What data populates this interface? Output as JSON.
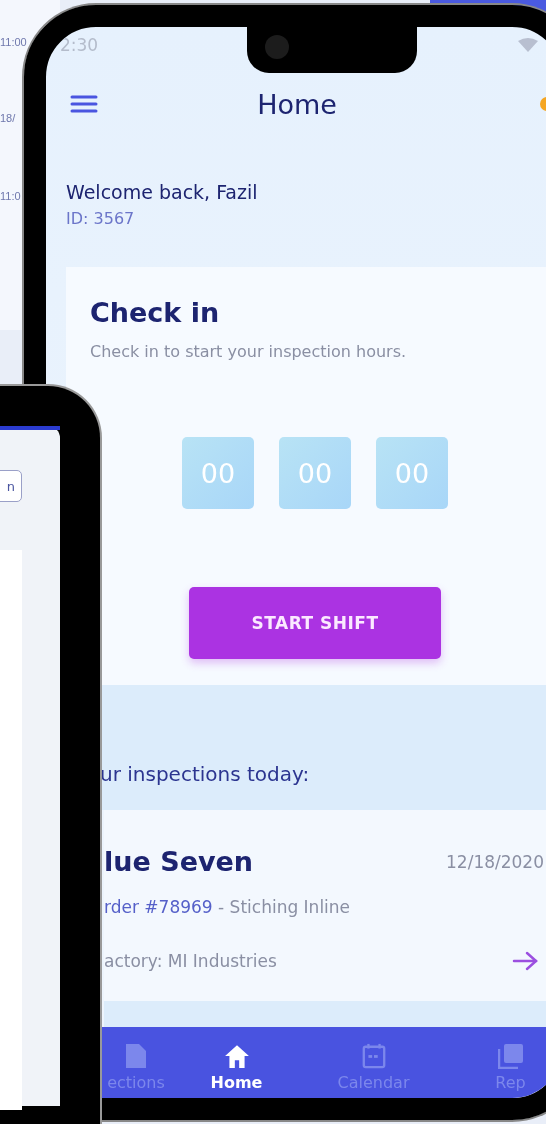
{
  "back_tablet": {
    "times": [
      "11:00",
      "18/",
      "11:0"
    ]
  },
  "phone": {
    "status_bar": {
      "time": "2:30"
    },
    "header": {
      "title": "Home"
    },
    "welcome": "Welcome back, Fazil",
    "user_id": "ID: 3567",
    "check_in": {
      "title": "Check in",
      "subtitle": "Check in to start your inspection hours.",
      "timer": [
        "00",
        "00",
        "00"
      ],
      "button": "START SHIFT"
    },
    "inspections": {
      "heading": "ur inspections today:",
      "items": [
        {
          "name": "lue Seven",
          "date": "12/18/2020",
          "order": "rder #78969",
          "task": "- Stiching Inline",
          "factory": "actory: MI Industries"
        }
      ]
    },
    "bottom_nav": [
      {
        "kind": "document",
        "label": "ections",
        "selected": false
      },
      {
        "kind": "home",
        "label": "Home",
        "selected": true
      },
      {
        "kind": "calendar",
        "label": "Calendar",
        "selected": false
      },
      {
        "kind": "reports",
        "label": "Rep",
        "selected": false
      }
    ]
  },
  "front_tablet": {
    "button": "n"
  }
}
